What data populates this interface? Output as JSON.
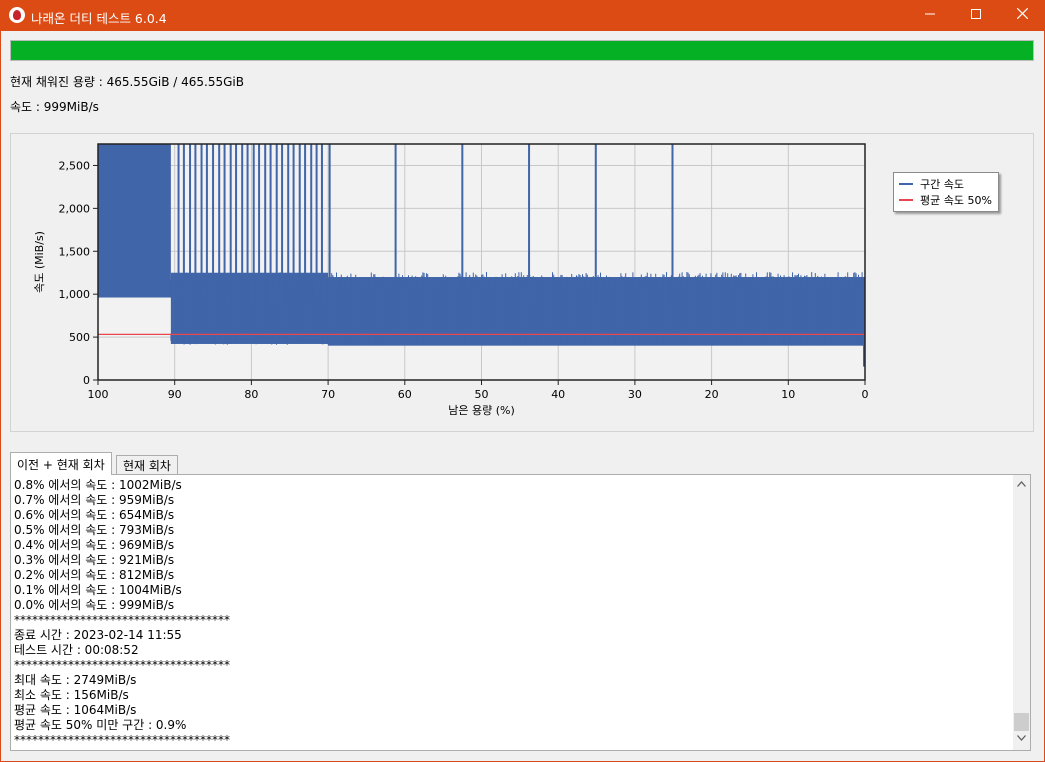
{
  "window": {
    "title": "나래온 더티 테스트 6.0.4",
    "minimize_icon": "minimize-icon",
    "maximize_icon": "maximize-icon",
    "close_icon": "close-icon"
  },
  "progress": {
    "value": 1.0,
    "color": "#06b025"
  },
  "status": {
    "capacity": "현재 채워진 용량 : 465.55GiB / 465.55GiB",
    "speed": "속도 : 999MiB/s"
  },
  "chart_data": {
    "type": "line",
    "xlabel": "남은 용량 (%)",
    "ylabel": "속도 (MiB/s)",
    "xlim": [
      100,
      0
    ],
    "ylim": [
      0,
      2750
    ],
    "x_ticks": [
      "100",
      "90",
      "80",
      "70",
      "60",
      "50",
      "40",
      "30",
      "20",
      "10",
      "0"
    ],
    "y_ticks": [
      "2,500",
      "2,000",
      "1,500",
      "1,000",
      "500",
      "0"
    ],
    "y_tick_values": [
      2500,
      2000,
      1500,
      1000,
      500,
      0
    ],
    "grid": true,
    "legend_position": "right",
    "series": [
      {
        "name": "구간 속도",
        "color": "#4065a8",
        "segments": [
          {
            "x_from": 100,
            "x_to": 90.5,
            "low": 960,
            "high": 2749
          },
          {
            "x_from": 90.5,
            "x_to": 70,
            "low": 420,
            "high": 1250
          },
          {
            "x_from": 70,
            "x_to": 0,
            "low": 400,
            "high": 1200
          }
        ],
        "spikes_x": [
          89.5,
          88.8,
          88,
          87.3,
          86.5,
          85.8,
          85,
          84.2,
          83.5,
          82.7,
          82,
          81.2,
          80.5,
          79.7,
          79,
          78.2,
          77.5,
          76.7,
          76,
          75.2,
          74.5,
          73.7,
          73,
          72.2,
          71.5,
          70.8,
          69.8,
          61.2,
          52.5,
          43.8,
          35.1,
          25.1
        ],
        "spike_value": 2749,
        "final_dip": 156
      },
      {
        "name": "평균 속도 50%",
        "color": "#e8474f",
        "value": 532
      }
    ]
  },
  "tabs": [
    {
      "label": "이전 + 현재 회차",
      "active": true
    },
    {
      "label": "현재 회차",
      "active": false
    }
  ],
  "log_lines": [
    "0.8% 에서의 속도 : 1002MiB/s",
    "0.7% 에서의 속도 : 959MiB/s",
    "0.6% 에서의 속도 : 654MiB/s",
    "0.5% 에서의 속도 : 793MiB/s",
    "0.4% 에서의 속도 : 969MiB/s",
    "0.3% 에서의 속도 : 921MiB/s",
    "0.2% 에서의 속도 : 812MiB/s",
    "0.1% 에서의 속도 : 1004MiB/s",
    "0.0% 에서의 속도 : 999MiB/s",
    "************************************",
    "종료 시간 : 2023-02-14 11:55",
    "테스트 시간 : 00:08:52",
    "************************************",
    "최대 속도 : 2749MiB/s",
    "최소 속도 : 156MiB/s",
    "평균 속도 : 1064MiB/s",
    "평균 속도 50% 미만 구간 : 0.9%",
    "************************************"
  ],
  "scrollbar": {
    "up_icon": "chevron-up-icon",
    "down_icon": "chevron-down-icon",
    "position": 0.95
  }
}
